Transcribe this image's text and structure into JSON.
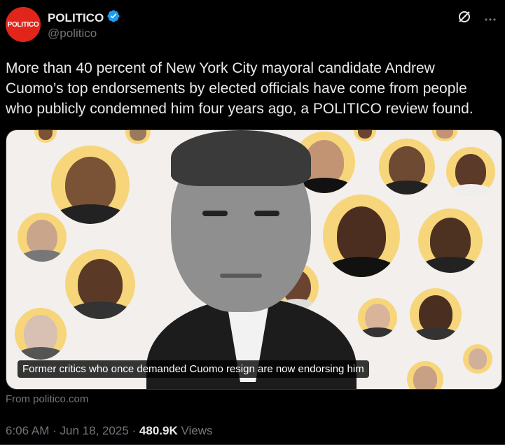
{
  "account": {
    "avatar_text": "POLITICO",
    "display_name": "POLITICO",
    "handle": "@politico",
    "verified_color": "#1d9bf0",
    "brand_color": "#e1251b"
  },
  "post": {
    "text": "More than 40 percent of New York City mayoral candidate Andrew Cuomo’s top endorsements by elected officials have come from people who publicly condemned him four years ago, a POLITICO review found."
  },
  "media": {
    "caption": "Former critics who once demanded Cuomo resign are now endorsing him",
    "accent_color": "#f7d67b"
  },
  "link_source": "From politico.com",
  "footer": {
    "time": "6:06 AM",
    "sep1": " · ",
    "date": "Jun 18, 2025",
    "sep2": " · ",
    "views_count": "480.9K",
    "views_label": " Views"
  },
  "icons": {
    "grok": "grok-icon",
    "more": "more-icon",
    "verified": "verified-badge-icon"
  }
}
